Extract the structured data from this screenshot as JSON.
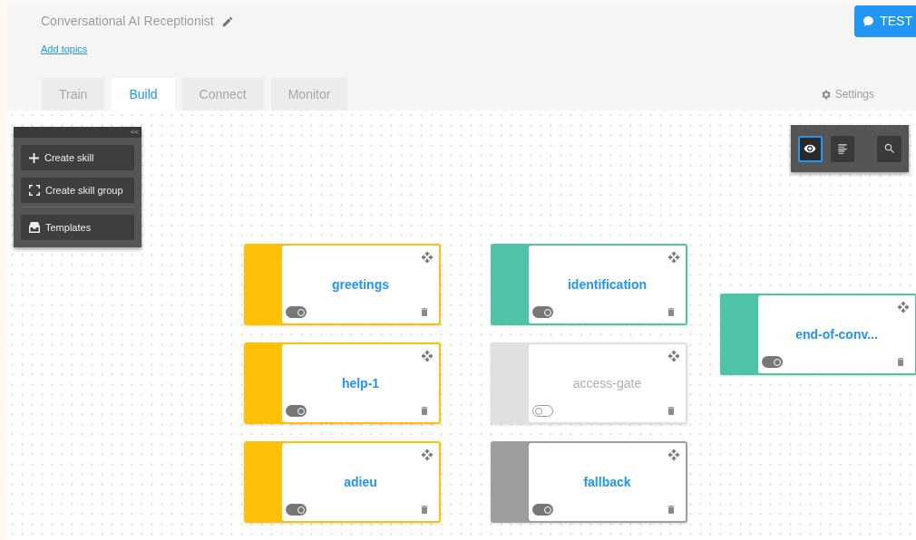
{
  "header": {
    "title": "Conversational AI Receptionist",
    "add_topics_link": "Add topics",
    "test_button": "TEST"
  },
  "tabs": [
    {
      "label": "Train",
      "selected": false
    },
    {
      "label": "Build",
      "selected": true
    },
    {
      "label": "Connect",
      "selected": false
    },
    {
      "label": "Monitor",
      "selected": false
    }
  ],
  "settings_link": "Settings",
  "side_panel": {
    "collapse": "<<",
    "buttons": [
      {
        "kind": "plus",
        "label": "Create skill"
      },
      {
        "kind": "group",
        "label": "Create skill group"
      },
      {
        "kind": "templates",
        "label": "Templates"
      }
    ]
  },
  "view_toolbar": [
    {
      "kind": "eye",
      "selected": true
    },
    {
      "kind": "list",
      "selected": false
    },
    {
      "kind": "search",
      "selected": false
    }
  ],
  "skills": [
    {
      "name": "greetings",
      "color": "#ffc107",
      "enabled": true
    },
    {
      "name": "help-1",
      "color": "#ffc107",
      "enabled": true
    },
    {
      "name": "adieu",
      "color": "#ffc107",
      "enabled": true
    },
    {
      "name": "identification",
      "color": "#4fc3a9",
      "enabled": true
    },
    {
      "name": "access-gate",
      "color": "#e0e0e0",
      "enabled": false
    },
    {
      "name": "fallback",
      "color": "#9e9e9e",
      "enabled": true
    },
    {
      "name": "end-of-conv...",
      "color": "#4fc3a9",
      "enabled": true
    }
  ]
}
